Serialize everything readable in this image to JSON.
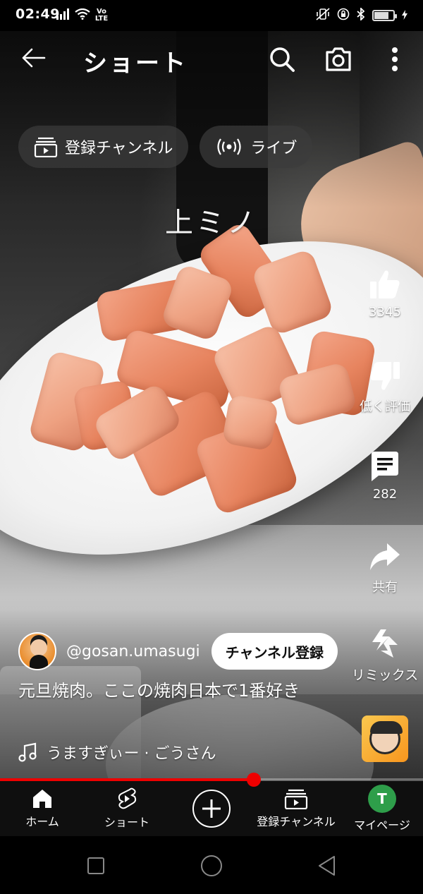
{
  "status_bar": {
    "time": "02:49",
    "network_label": "Vo LTE"
  },
  "top_nav": {
    "title": "ショート"
  },
  "chips": [
    {
      "label": "登録チャンネル",
      "icon": "subscriptions-icon"
    },
    {
      "label": "ライブ",
      "icon": "live-icon"
    }
  ],
  "video": {
    "overlay_caption": "上ミノ"
  },
  "actions": {
    "like_count": "3345",
    "dislike_label": "低く評価",
    "comment_count": "282",
    "share_label": "共有",
    "remix_label": "リミックス"
  },
  "channel": {
    "handle": "@gosan.umasugi",
    "subscribe_label": "チャンネル登録"
  },
  "video_title": "元旦焼肉。ここの焼肉日本で1番好き",
  "music": {
    "track": "うますぎぃー · ごうさん"
  },
  "progress": {
    "fraction": 0.6
  },
  "bottom_nav": {
    "home": "ホーム",
    "shorts": "ショート",
    "subscriptions": "登録チャンネル",
    "you": "マイページ",
    "avatar_letter": "T"
  },
  "colors": {
    "accent": "#ff0000",
    "avatar_bg": "#2e9e4a"
  }
}
